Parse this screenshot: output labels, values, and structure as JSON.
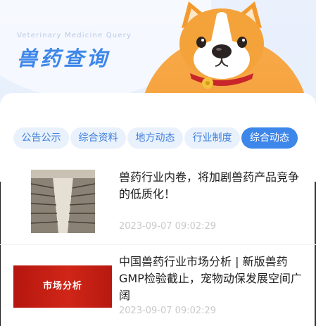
{
  "header": {
    "subtitle": "Veterinary Medicine Query",
    "title": "兽药查询",
    "colors": {
      "title": "#3d86ea",
      "sun": "#f59a31",
      "background": "#e9f1fd"
    }
  },
  "tabs": [
    {
      "label": "公告公示",
      "active": false
    },
    {
      "label": "综合资料",
      "active": false
    },
    {
      "label": "地方动态",
      "active": false
    },
    {
      "label": "行业制度",
      "active": false
    },
    {
      "label": "综合动态",
      "active": true
    }
  ],
  "articles": [
    {
      "title": "兽药行业内卷，将加剧兽药产品竞争的低质化！",
      "date": "2023-09-07 09:02:29",
      "thumbnail": "poultry-house-photo"
    },
    {
      "title": "中国兽药行业市场分析 | 新版兽药GMP检验截止，宠物动保发展空间广阔",
      "date": "2023-09-07 09:02:29",
      "thumbnail": "market-analysis-banner",
      "thumbnail_text": "市场分析"
    }
  ]
}
